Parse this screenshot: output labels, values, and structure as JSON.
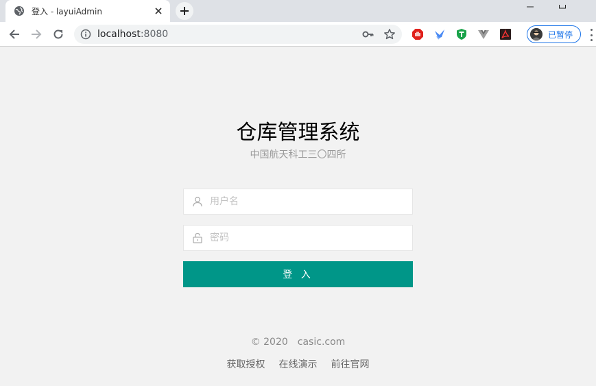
{
  "browser": {
    "tab": {
      "title": "登入 - layuiAdmin",
      "favicon": "globe-icon"
    },
    "address": {
      "host": "localhost",
      "port": ":8080"
    },
    "profile": {
      "label": "已暂停"
    },
    "extensions": [
      "adblock-icon",
      "bird-extension-icon",
      "shield-t-icon",
      "vue-devtools-icon",
      "pdf-icon"
    ],
    "colors": {
      "profile_accent": "#1a73e8"
    }
  },
  "login": {
    "title": "仓库管理系统",
    "subtitle": "中国航天科工三〇四所",
    "username": {
      "placeholder": "用户名",
      "value": ""
    },
    "password": {
      "placeholder": "密码",
      "value": ""
    },
    "submit_label": "登 入",
    "accent": "#009688"
  },
  "footer": {
    "copyright": "© 2020",
    "company": "casic.com",
    "links": [
      {
        "label": "获取授权"
      },
      {
        "label": "在线演示"
      },
      {
        "label": "前往官网"
      }
    ]
  }
}
